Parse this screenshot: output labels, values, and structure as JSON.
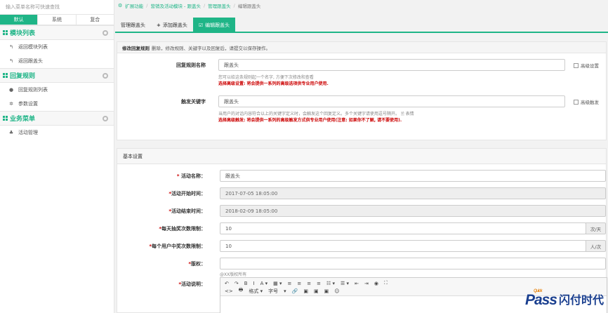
{
  "sidebar": {
    "search_placeholder": "输入菜单名称可快速查找",
    "tabs": [
      "默认",
      "系统",
      "复合"
    ],
    "sections": [
      {
        "title": "模块列表",
        "items": [
          {
            "label": "返回模块列表",
            "icon": "back-icon"
          },
          {
            "label": "返回跟盖头",
            "icon": "back-icon"
          }
        ]
      },
      {
        "title": "回复规则",
        "items": [
          {
            "label": "回复规则列表",
            "icon": "comments-icon"
          },
          {
            "label": "参数设置",
            "icon": "gear-icon"
          }
        ]
      },
      {
        "title": "业务菜单",
        "items": [
          {
            "label": "活动管理",
            "icon": "sitemap-icon"
          }
        ]
      }
    ]
  },
  "breadcrumb": [
    "扩展功能",
    "营销及活动模块 - 跟盖头",
    "管理跟盖头",
    "编辑跟盖头"
  ],
  "tabs": [
    "管理跟盖头",
    "添加跟盖头",
    "编辑跟盖头"
  ],
  "tab_icons": {
    "add": "+",
    "edit": "☑"
  },
  "reply_panel": {
    "head_bold": "修改回复规则",
    "head_text": "删除，修改规则、关键字以及回复后，请提交以保存操作。",
    "rule_name_label": "回复规则名称",
    "rule_name_value": "跟盖头",
    "rule_help": "您可以给这条规则起一个名字, 方便下次修改和查看",
    "rule_help_red": "选择高级设置: 将会提供一系列的高级选项供专业用户使用.",
    "advanced_settings": "高级设置",
    "keyword_label": "触发关键字",
    "keyword_value": "跟盖头",
    "keyword_help": "当用户的对话内容符合以上的关键字定义时，会触发这个回复定义。多个关键字请使用逗号隔开。",
    "emoji_label": "表情",
    "keyword_help_red": "选择高级触发: 将会提供一系列的高级触发方式供专业用户使用(注意: 如果你不了解, 请不要使用).",
    "advanced_trigger": "高级触发"
  },
  "basic_panel": {
    "title": "基本设置",
    "fields": {
      "name": {
        "label": "活动名称：",
        "value": "跟盖头"
      },
      "start": {
        "label": "活动开始时间：",
        "value": "2017-07-05 18:05:00"
      },
      "end": {
        "label": "活动结束时间：",
        "value": "2018-02-09 18:05:00"
      },
      "daily": {
        "label": "每天抽奖次数限制：",
        "value": "10",
        "unit": "次/天"
      },
      "per_user": {
        "label": "每个用户中奖次数限制：",
        "value": "10",
        "unit": "人/次"
      },
      "copyright": {
        "label": "版权：",
        "value": "",
        "help": "@XX版权所有"
      },
      "desc": {
        "label": "活动说明："
      }
    },
    "toolbar_row1": [
      "↶",
      "↷",
      "B",
      "I",
      "A ▾",
      "▦ ▾",
      "≡",
      "≡",
      "≡",
      "≡",
      "☷ ▾",
      "☰ ▾",
      "⇤",
      "⇥",
      "◉",
      "⛶"
    ],
    "toolbar_row2": [
      "<>",
      "🖶",
      "格式 ▾",
      "字号",
      "▾",
      "🔗",
      "▣",
      "▣",
      "▣",
      "☺"
    ]
  },
  "logo": {
    "quick": "Quick",
    "pass": "Pass",
    "cn": "闪付时代"
  }
}
